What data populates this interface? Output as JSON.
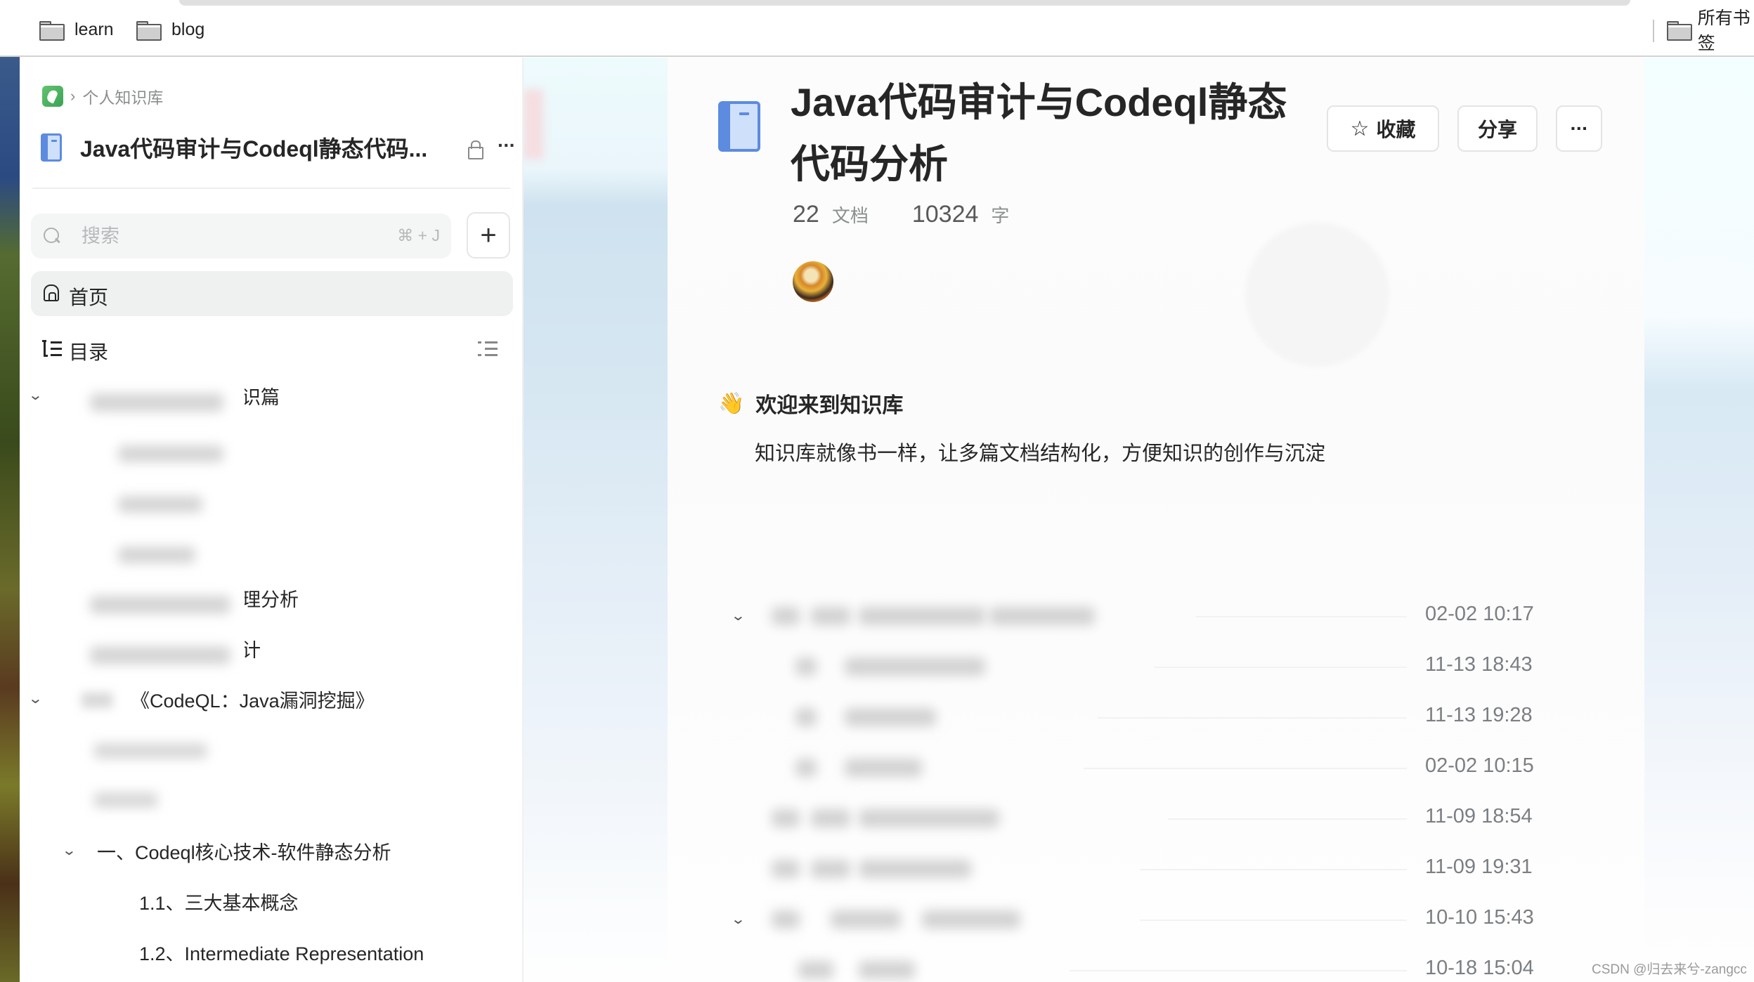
{
  "browser": {
    "bookmarks": [
      {
        "label": "learn",
        "icon": "folder-icon"
      },
      {
        "label": "blog",
        "icon": "folder-icon"
      }
    ],
    "bookmarks_overflow": {
      "label": "所有书签",
      "icon": "folder-icon"
    }
  },
  "sidebar": {
    "breadcrumb": {
      "app_icon": "yuque-logo-icon",
      "separator": "›",
      "label": "个人知识库"
    },
    "book_title": "Java代码审计与Codeql静态代码...",
    "lock_icon": "lock-icon",
    "more_label": "···",
    "search": {
      "placeholder": "搜索",
      "value": "",
      "shortcut": "⌘ + J"
    },
    "add_label": "+",
    "nav": [
      {
        "label": "首页",
        "icon": "home-icon",
        "active": true
      },
      {
        "label": "目录",
        "icon": "toc-icon",
        "active": false
      }
    ],
    "tree": [
      {
        "label": "基础知识篇",
        "level": 0,
        "expanded": true,
        "blurred_prefix": true
      },
      {
        "label": "境搭建",
        "level": 1,
        "blurred_prefix": true
      },
      {
        "label": "",
        "level": 1,
        "blurred_prefix": true
      },
      {
        "label": "",
        "level": 1,
        "blurred_prefix": true
      },
      {
        "label": "漏洞原理分析",
        "level": 0,
        "blurred_prefix": true
      },
      {
        "label": "代码审计",
        "level": 0,
        "blurred_prefix": true
      },
      {
        "label": "《CodeQL：Java漏洞挖掘》",
        "level": 0,
        "expanded": true,
        "blurred_prefix": true
      },
      {
        "label": "",
        "level": 1,
        "blurred_prefix": true
      },
      {
        "label": "",
        "level": 1,
        "blurred_prefix": true
      },
      {
        "label": "一、Codeql核心技术-软件静态分析",
        "level": 1,
        "expanded": true
      },
      {
        "label": "1.1、三大基本概念",
        "level": 2
      },
      {
        "label": "1.2、Intermediate Representation",
        "level": 2
      }
    ]
  },
  "main": {
    "title": "Java代码审计与Codeql静态代码分析",
    "actions": {
      "favorite": "收藏",
      "share": "分享",
      "more": "···"
    },
    "stats": {
      "docs_count": "22",
      "docs_unit": "文档",
      "words_count": "10324",
      "words_unit": "字"
    },
    "welcome": {
      "emoji": "👋",
      "title": "欢迎来到知识库",
      "description": "知识库就像书一样，让多篇文档结构化，方便知识的创作与沉淀"
    },
    "docs": [
      {
        "title": "",
        "time": "02-02 10:17",
        "expandable": true
      },
      {
        "title": "",
        "time": "11-13 18:43"
      },
      {
        "title": "",
        "time": "11-13 19:28"
      },
      {
        "title": "",
        "time": "02-02 10:15"
      },
      {
        "title": "",
        "time": "11-09 18:54"
      },
      {
        "title": "",
        "time": "11-09 19:31"
      },
      {
        "title": "",
        "time": "10-10 15:43",
        "expandable": true
      },
      {
        "title": "",
        "time": "10-18 15:04"
      }
    ]
  },
  "watermark": "CSDN @归去来兮-zangcc",
  "colors": {
    "accent_book": "#5c8be0",
    "brand_green": "#3aa356",
    "active_nav_bg": "#eff0f0",
    "time_text": "#7b7f83"
  }
}
